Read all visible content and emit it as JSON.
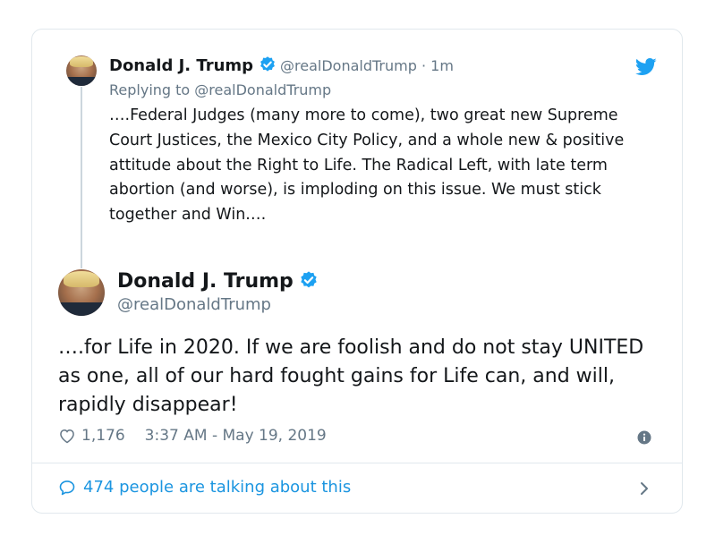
{
  "reply_tweet": {
    "name": "Donald J. Trump",
    "handle": "@realDonaldTrump",
    "time": "· 1m",
    "replying_to": "Replying to @realDonaldTrump",
    "text": "….Federal Judges (many more to come), two great new Supreme Court Justices, the Mexico City Policy, and a whole new & positive attitude about the Right to Life. The Radical Left, with late term abortion (and worse), is imploding on this issue. We must stick together and Win.…"
  },
  "main_tweet": {
    "name": "Donald J. Trump",
    "handle": "@realDonaldTrump",
    "text": "….for Life in 2020. If we are foolish and do not stay UNITED as one, all of our hard fought gains for Life can, and will, rapidly disappear!",
    "likes": "1,176",
    "timestamp": "3:37 AM - May 19, 2019"
  },
  "footer": {
    "talking_label": "474 people are talking about this"
  },
  "icons": {
    "brand": "twitter-bird-icon",
    "verified": "verified-badge-icon",
    "like": "heart-icon",
    "info": "info-icon",
    "reply": "speech-bubble-icon",
    "more": "chevron-right-icon"
  },
  "colors": {
    "accent": "#1da1f2",
    "link": "#1b95e0",
    "muted": "#657786",
    "text": "#14171a"
  }
}
